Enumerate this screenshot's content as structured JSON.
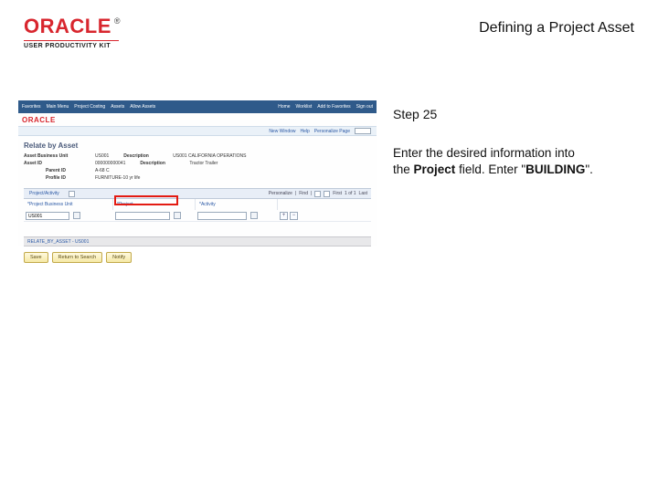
{
  "header": {
    "brand": "ORACLE",
    "registered": "®",
    "product_line": "USER PRODUCTIVITY KIT",
    "title": "Defining a Project Asset"
  },
  "instruction": {
    "step_label": "Step 25",
    "line1": "Enter the desired information into",
    "line2a": "the ",
    "line2b": "Project",
    "line2c": " field. Enter \"",
    "line2d": "BUILDING",
    "line2e": "\"."
  },
  "screenshot": {
    "topnav": {
      "left": [
        "Favorites",
        "Main Menu",
        "Project Costing",
        "Assets",
        "Allow Assets"
      ],
      "right": [
        "Home",
        "Worklist",
        "Add to Favorites",
        "Sign out"
      ]
    },
    "brand_mini": "ORACLE",
    "subbar": {
      "new_window": "New Window",
      "help": "Help",
      "personalize": "Personalize Page"
    },
    "section_title": "Relate by Asset",
    "fields": {
      "r1": {
        "k1": "Asset Business Unit",
        "v1": "US001",
        "k2": "Description",
        "v2": "US001 CALIFORNIA OPERATIONS"
      },
      "r2": {
        "k1": "Asset ID",
        "v1": "000000000041",
        "k2": "Description",
        "v2": "Tractor Trailer"
      },
      "r3": {
        "k1": "Parent ID",
        "v1": "A-68 C"
      },
      "r4": {
        "k1": "Profile ID",
        "v1": "FURNITURE-10 yr life"
      }
    },
    "grid": {
      "tab": "Project/Activity",
      "tools": {
        "personalize": "Personalize",
        "find": "Find",
        "range": "1 of 1",
        "first": "First",
        "last": "Last"
      },
      "cols": {
        "c1": "*Project Business Unit",
        "c2": "*Project",
        "c3": "*Activity"
      },
      "row": {
        "bu": "US001"
      }
    },
    "grayband": "RELATE_BY_ASSET - US001",
    "buttons": {
      "save": "Save",
      "return": "Return to Search",
      "notify": "Notify"
    }
  }
}
